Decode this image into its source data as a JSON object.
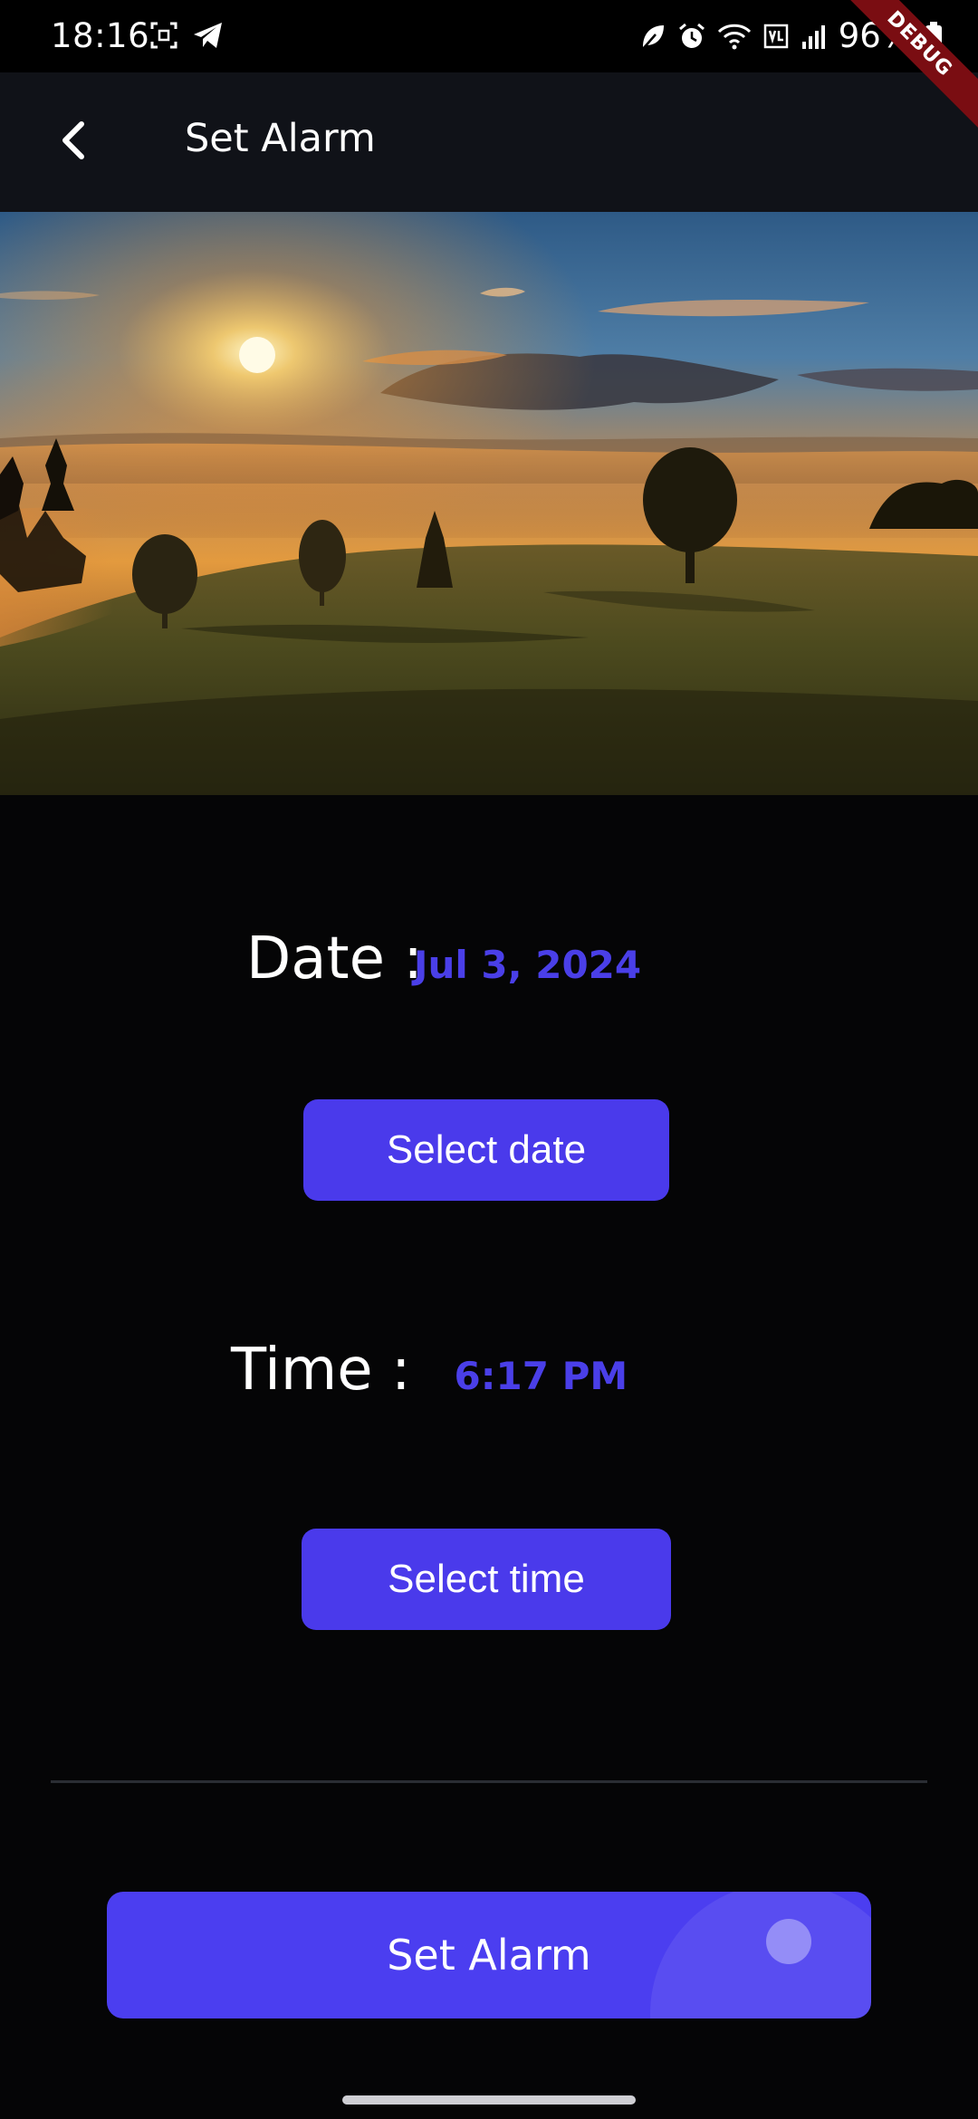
{
  "status_bar": {
    "time": "18:16",
    "battery": "96%",
    "left_icons": [
      "screenshot-icon",
      "telegram-icon"
    ],
    "right_icons": [
      "leaf-icon",
      "alarm-icon",
      "wifi-icon",
      "volte-icon",
      "signal-icon",
      "battery-icon"
    ]
  },
  "debug_banner": "DEBUG",
  "app_bar": {
    "back_icon": "back-arrow-icon",
    "title": "Set Alarm"
  },
  "date": {
    "label": "Date :",
    "value": "Jul 3, 2024",
    "button": "Select date"
  },
  "time": {
    "label": "Time :",
    "value": "6:17 PM",
    "button": "Select time"
  },
  "set_alarm_button": "Set Alarm",
  "colors": {
    "accent": "#4a3aeb",
    "value_text": "#4a3fe8",
    "app_bar": "#101218",
    "background": "#050506"
  }
}
